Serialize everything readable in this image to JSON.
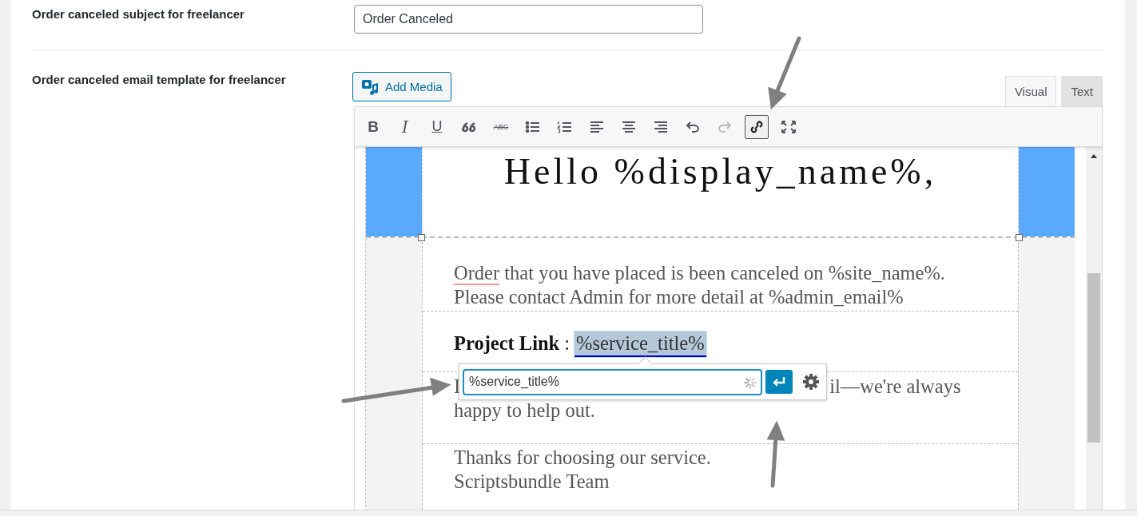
{
  "subject": {
    "label": "Order canceled subject for freelancer",
    "value": "Order Canceled"
  },
  "template": {
    "label": "Order canceled email template for freelancer",
    "add_media": "Add Media",
    "tabs": [
      {
        "label": "Visual",
        "selected": true
      },
      {
        "label": "Text",
        "selected": false
      }
    ],
    "toolbar": [
      {
        "kind": "bold",
        "label": "B",
        "active": false,
        "disabled": false
      },
      {
        "kind": "italic",
        "label": "I",
        "active": false,
        "disabled": false
      },
      {
        "kind": "underline",
        "label": "U",
        "active": false,
        "disabled": false
      },
      {
        "kind": "quote",
        "active": false,
        "disabled": false
      },
      {
        "kind": "strike",
        "label": "ABC",
        "active": false,
        "disabled": false
      },
      {
        "kind": "bullets",
        "active": false,
        "disabled": false
      },
      {
        "kind": "numbers",
        "active": false,
        "disabled": false
      },
      {
        "kind": "align-left",
        "active": false,
        "disabled": false
      },
      {
        "kind": "align-center",
        "active": false,
        "disabled": false
      },
      {
        "kind": "align-right",
        "active": false,
        "disabled": false
      },
      {
        "kind": "undo",
        "active": false,
        "disabled": false
      },
      {
        "kind": "redo",
        "active": false,
        "disabled": true
      },
      {
        "kind": "link",
        "active": true,
        "disabled": false
      },
      {
        "kind": "fullscreen",
        "active": false,
        "disabled": false
      }
    ],
    "email": {
      "greeting": "Hello %display_name%,",
      "intro_lines": [
        {
          "parts": [
            {
              "text": "Order",
              "misspelled": true
            },
            {
              "text": " that you have placed is been canceled on %site_name%.",
              "misspelled": false
            }
          ]
        },
        {
          "parts": [
            {
              "text": "Please contact Admin for more detail at %admin_email%",
              "misspelled": false
            }
          ]
        }
      ],
      "project_link": {
        "label": "Project Link",
        "separator": ":",
        "value": "%service_title%",
        "selected": true
      },
      "covered_line": {
        "start": "I",
        "end": "il—we're always"
      },
      "help_line": "happy to help out.",
      "closing_lines": [
        "Thanks for choosing our service.",
        "Scriptsbundle Team"
      ]
    },
    "link_popup": {
      "value": "%service_title%",
      "busy": true
    }
  }
}
